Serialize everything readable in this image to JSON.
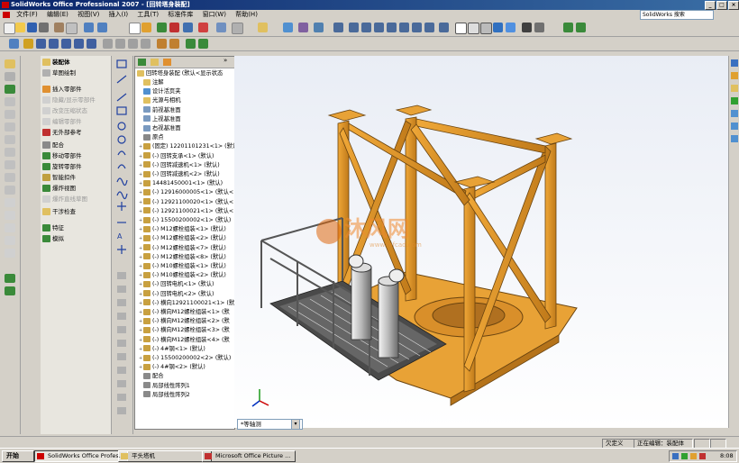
{
  "window": {
    "title": "SolidWorks Office Professional 2007 - [回转塔身装配]",
    "minimize": "_",
    "maximize": "□",
    "close": "×"
  },
  "menubar": {
    "items": [
      "文件(F)",
      "编辑(E)",
      "视图(V)",
      "插入(I)",
      "工具(T)",
      "标准件库",
      "窗口(W)",
      "帮助(H)"
    ],
    "help_search_placeholder": "SolidWorks 搜索"
  },
  "command_manager": {
    "items": [
      {
        "label": "装配体",
        "enabled": true
      },
      {
        "label": "草图绘制",
        "enabled": true
      },
      {
        "label": "插入零部件",
        "enabled": true
      },
      {
        "label": "隐藏/显示零部件",
        "enabled": false
      },
      {
        "label": "改变压缩状态",
        "enabled": false
      },
      {
        "label": "编辑零部件",
        "enabled": false
      },
      {
        "label": "无外部参考",
        "enabled": true
      },
      {
        "label": "配合",
        "enabled": true
      },
      {
        "label": "移动零部件",
        "enabled": true
      },
      {
        "label": "旋转零部件",
        "enabled": true
      },
      {
        "label": "智能扣件",
        "enabled": true
      },
      {
        "label": "爆炸视图",
        "enabled": true
      },
      {
        "label": "爆炸直线草图",
        "enabled": false
      },
      {
        "label": "干涉检查",
        "enabled": true
      },
      {
        "label": "特征",
        "enabled": true
      },
      {
        "label": "模拟",
        "enabled": true
      }
    ]
  },
  "feature_tree": {
    "root": "回转塔身装配 (默认<显示状态",
    "items": [
      "注解",
      "设计活页夹",
      "光源与相机",
      "前视基准面",
      "上视基准面",
      "右视基准面",
      "原点",
      "(固定) 12201101231<1> (默认",
      "(-) 回转支承<1> (默认)",
      "(-) 回转减速机<1> (默认)",
      "(-) 回转减速机<2> (默认)",
      "14481450001<1> (默认)",
      "(-) 12916000005<1> (默认<",
      "(-) 12921100020<1> (默认<",
      "(-) 12921100021<1> (默认<",
      "(-) 15500200002<1> (默认)",
      "(-) M12螺栓组装<1> (默认)",
      "(-) M12螺栓组装<2> (默认)",
      "(-) M12螺栓组装<7> (默认)",
      "(-) M12螺栓组装<8> (默认)",
      "(-) M10螺栓组装<1> (默认)",
      "(-) M10螺栓组装<2> (默认)",
      "(-) 回转电机<1> (默认)",
      "(-) 回转电机<2> (默认)",
      "(-) 横向12921100021<1> (默",
      "(-) 横向M12螺栓组装<1> (默",
      "(-) 横向M12螺栓组装<2> (默",
      "(-) 横向M12螺栓组装<3> (默",
      "(-) 横向M12螺栓组装<4> (默",
      "(-) 4#钢<1> (默认)",
      "(-) 15500200002<2> (默认)",
      "(-) 4#钢<2> (默认)",
      "配合",
      "局部线性阵列1",
      "局部线性阵列2"
    ]
  },
  "viewport": {
    "view_selector": "*等轴测",
    "watermark_brand": "沐风网",
    "watermark_url": "www.mfcad.com"
  },
  "statusbar": {
    "status": "欠定义",
    "mode": "正在编辑：装配体"
  },
  "taskbar": {
    "start": "开始",
    "tasks": [
      {
        "label": "SolidWorks Office Profes...",
        "active": true
      },
      {
        "label": "平头塔机",
        "active": false
      },
      {
        "label": "Microsoft Office Picture ...",
        "active": false
      }
    ],
    "clock": "8:08"
  },
  "colors": {
    "frame_orange": "#e89a2a",
    "frame_dark": "#b5731a",
    "titlebar_start": "#0a246a",
    "titlebar_end": "#3a6ea5"
  }
}
